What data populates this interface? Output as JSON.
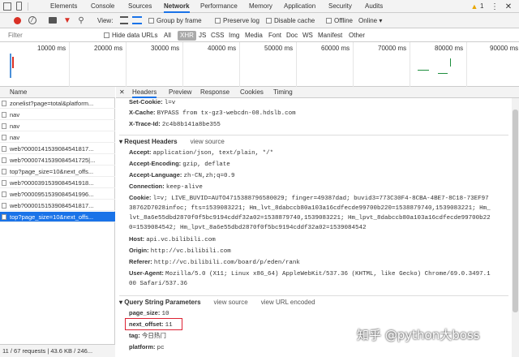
{
  "tabs": [
    "Elements",
    "Console",
    "Sources",
    "Network",
    "Performance",
    "Memory",
    "Application",
    "Security",
    "Audits"
  ],
  "warnings": "1",
  "toolbar": {
    "view_label": "View:",
    "group_by_frame": "Group by frame",
    "preserve_log": "Preserve log",
    "disable_cache": "Disable cache",
    "offline": "Offline",
    "throttle": "Online"
  },
  "filter": {
    "placeholder": "Filter",
    "hide_data_urls": "Hide data URLs",
    "types": [
      "All",
      "XHR",
      "JS",
      "CSS",
      "Img",
      "Media",
      "Font",
      "Doc",
      "WS",
      "Manifest",
      "Other"
    ]
  },
  "overview": {
    "ticks": [
      "10000 ms",
      "20000 ms",
      "30000 ms",
      "40000 ms",
      "50000 ms",
      "60000 ms",
      "70000 ms",
      "80000 ms",
      "90000 ms"
    ]
  },
  "requests": {
    "header": "Name",
    "items": [
      "zonelist?page=total&platform...",
      "nav",
      "nav",
      "nav",
      "web?0000141539084541817...",
      "web?0000741539084541725|...",
      "top?page_size=10&next_offs...",
      "web?0000391539084541918...",
      "web?0000951539084541996...",
      "web?0000151539084541817...",
      "top?page_size=10&next_offs..."
    ],
    "status": "11 / 67 requests  |  43.6 KB / 246..."
  },
  "detail_tabs": [
    "Headers",
    "Preview",
    "Response",
    "Cookies",
    "Timing"
  ],
  "response_headers_tail": [
    {
      "k": "Set-Cookie:",
      "v": "l=v"
    },
    {
      "k": "X-Cache:",
      "v": "BYPASS from tx-gz3-webcdn-08.hdslb.com"
    },
    {
      "k": "X-Trace-Id:",
      "v": "2c4b8b141a8be355"
    }
  ],
  "request_headers": {
    "title": "Request Headers",
    "link": "view source",
    "rows": [
      {
        "k": "Accept:",
        "v": "application/json, text/plain, */*"
      },
      {
        "k": "Accept-Encoding:",
        "v": "gzip, deflate"
      },
      {
        "k": "Accept-Language:",
        "v": "zh-CN,zh;q=0.9"
      },
      {
        "k": "Connection:",
        "v": "keep-alive"
      },
      {
        "k": "Cookie:",
        "v": "l=v; LIVE_BUVID=AUTO4715388796580029; finger=49387dad; buvid3=773C30F4-8CBA-4BE7-8C18-73EF97"
      },
      {
        "k": "",
        "v": "38762D7028infoc; fts=1539083221; Hm_lvt_8dabccb80a103a16cdfecde99700b220=1538879740,1539083221; Hm_"
      },
      {
        "k": "",
        "v": "lvt_8a6e55dbd2870f0f5bc9194cddf32a02=1538879740,1539083221; Hm_lpvt_8dabccb80a103a16cdfecde99700b22"
      },
      {
        "k": "",
        "v": "0=1539084542; Hm_lpvt_8a6e55dbd2870f0f5bc9194cddf32a02=1539084542"
      },
      {
        "k": "Host:",
        "v": "api.vc.bilibili.com"
      },
      {
        "k": "Origin:",
        "v": "http://vc.bilibili.com"
      },
      {
        "k": "Referer:",
        "v": "http://vc.bilibili.com/board/p/eden/rank"
      },
      {
        "k": "User-Agent:",
        "v": "Mozilla/5.0 (X11; Linux x86_64) AppleWebKit/537.36 (KHTML, like Gecko) Chrome/69.0.3497.1"
      },
      {
        "k": "",
        "v": "00 Safari/537.36"
      }
    ]
  },
  "query_params": {
    "title": "Query String Parameters",
    "link1": "view source",
    "link2": "view URL encoded",
    "rows": [
      {
        "k": "page_size:",
        "v": "10"
      },
      {
        "k": "next_offset:",
        "v": "11"
      },
      {
        "k": "tag:",
        "v": "今日热门"
      },
      {
        "k": "platform:",
        "v": "pc"
      }
    ]
  },
  "watermark": "知乎 @python大boss",
  "colors": {
    "accent": "#1a73e8",
    "record": "#d93025",
    "highlight": "#dd2233"
  }
}
